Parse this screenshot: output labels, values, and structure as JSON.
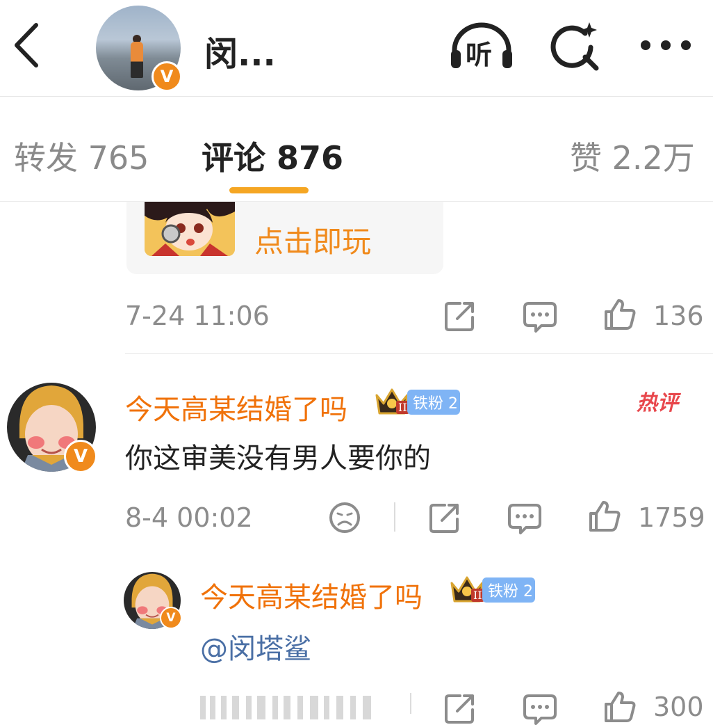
{
  "header": {
    "title": "闵...",
    "listen_label": "听",
    "verified_mark": "V",
    "icons": [
      "back-icon",
      "listen-icon",
      "search-icon",
      "more-icon"
    ]
  },
  "tabs": [
    {
      "label": "转发 765",
      "active": false
    },
    {
      "label": "评论 876",
      "active": true
    },
    {
      "label": "赞 2.2万",
      "active": false
    }
  ],
  "game_card": {
    "cta": "点击即玩"
  },
  "post_meta": {
    "time": "7-24 11:06",
    "likes": "136"
  },
  "comments": [
    {
      "username": "今天高某结婚了吗",
      "fan_badge": "铁粉 2",
      "crown_level": "II",
      "tag": "热评",
      "text": "你这审美没有男人要你的",
      "time": "8-4 00:02",
      "likes": "1759",
      "reply": {
        "username": "今天高某结婚了吗",
        "fan_badge": "铁粉 2",
        "crown_level": "II",
        "text": "@闵塔鲨",
        "likes": "300"
      }
    }
  ],
  "colors": {
    "accent": "#f5a623",
    "username": "#f0720a",
    "verified": "#f08a1c",
    "fan_badge": "#7fb4f5",
    "hot": "#e8474c",
    "mention": "#4a6fa5"
  }
}
